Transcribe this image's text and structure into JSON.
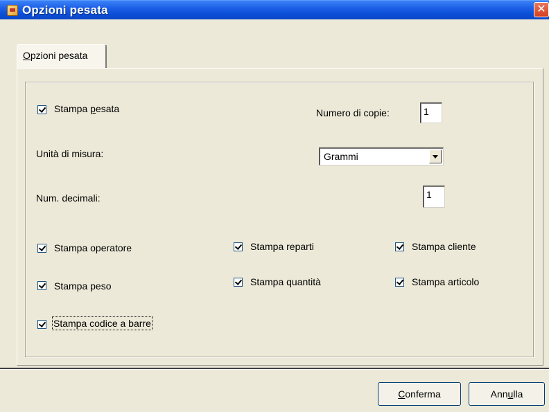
{
  "window": {
    "title": "Opzioni pesata"
  },
  "tab": {
    "label_underline": "O",
    "label_rest": "pzioni pesata"
  },
  "options": {
    "stampa_pesata": {
      "pre": "Stampa ",
      "ul": "p",
      "post": "esata",
      "checked": true
    },
    "copies_label": "Numero di copie:",
    "copies_value": "1",
    "unit_label": "Unità di misura:",
    "unit_value": "Grammi",
    "decimals_label": "Num. decimali:",
    "decimals_value": "1",
    "checks": {
      "operatore": {
        "label": "Stampa operatore",
        "checked": true
      },
      "reparti": {
        "label": "Stampa reparti",
        "checked": true
      },
      "cliente": {
        "label": "Stampa cliente",
        "checked": true
      },
      "peso": {
        "label": "Stampa peso",
        "checked": true
      },
      "quantita": {
        "label": "Stampa quantità",
        "checked": true
      },
      "articolo": {
        "label": "Stampa articolo",
        "checked": true
      },
      "codice_barre": {
        "label": "Stampa codice a barre",
        "checked": true
      }
    }
  },
  "buttons": {
    "conferma_ul": "C",
    "conferma_rest": "onferma",
    "annulla_pre": "Ann",
    "annulla_ul": "u",
    "annulla_post": "lla"
  },
  "colors": {
    "titlebar": "#0b4fd8",
    "face": "#ece9d8",
    "close": "#d33f1f"
  }
}
